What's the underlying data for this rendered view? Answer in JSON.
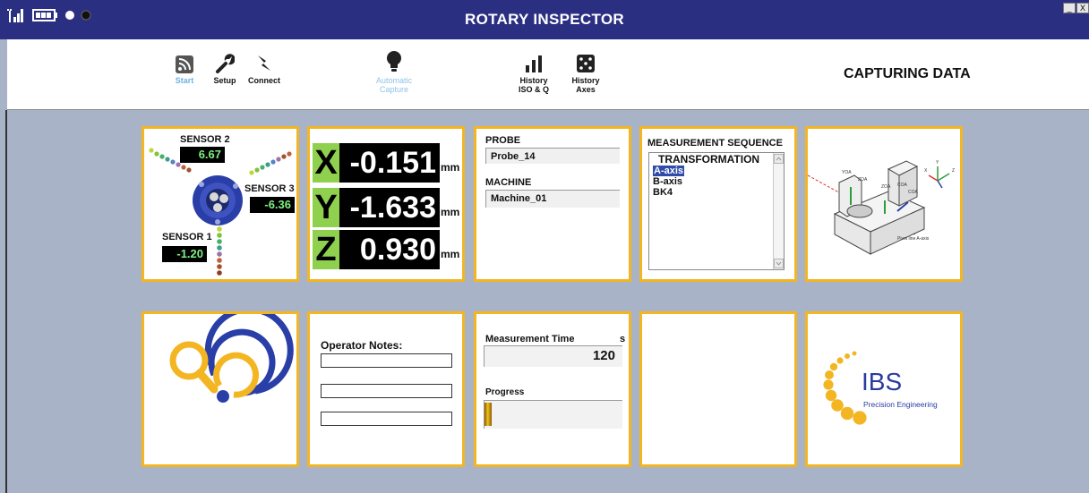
{
  "window": {
    "title": "ROTARY INSPECTOR",
    "minimize_label": "_",
    "close_label": "X"
  },
  "toolbar": {
    "start_label": "Start",
    "setup_label": "Setup",
    "connect_label": "Connect",
    "auto_line1": "Automatic",
    "auto_line2": "Capture",
    "history_iso_line1": "History",
    "history_iso_line2": "ISO & Q",
    "history_axes_line1": "History",
    "history_axes_line2": "Axes",
    "status": "CAPTURING DATA"
  },
  "sensors": {
    "s1_label": "SENSOR 1",
    "s1_value": "-1.20",
    "s2_label": "SENSOR 2",
    "s2_value": "6.67",
    "s3_label": "SENSOR 3",
    "s3_value": "-6.36"
  },
  "coords": {
    "x_letter": "X",
    "x_value": "-0.151",
    "y_letter": "Y",
    "y_value": "-1.633",
    "z_letter": "Z",
    "z_value": "0.930",
    "unit": "mm"
  },
  "probe": {
    "probe_label": "PROBE",
    "probe_value": "Probe_14",
    "machine_label": "MACHINE",
    "machine_value": "Machine_01"
  },
  "sequence": {
    "title": "MEASUREMENT SEQUENCE",
    "items": [
      "TRANSFORMATION",
      "A-axis",
      "B-axis",
      "BK4"
    ],
    "selected_index": 1
  },
  "diagram": {
    "labels": [
      "YOA",
      "ZOA",
      "ZOA",
      "COA",
      "COA",
      "X",
      "Y",
      "Z",
      "Pivot line A-axis"
    ]
  },
  "notes": {
    "label": "Operator Notes:"
  },
  "measurement": {
    "time_label": "Measurement Time",
    "time_unit": "s",
    "time_value": "120",
    "progress_label": "Progress",
    "progress_fraction": 0.05
  },
  "brand": {
    "logo_text": "IBS",
    "tagline": "Precision Engineering"
  },
  "colors": {
    "titlebar": "#2b2f82",
    "panel_border": "#f3b622",
    "background": "#a9b3c7",
    "coord_letter_bg": "#8fd14f",
    "sensor_value": "#7ff07f",
    "brand_blue": "#2a3aa0",
    "brand_yellow": "#f3b622"
  },
  "icons": [
    "signal-icon",
    "battery-icon",
    "status-dot-white-icon",
    "status-dot-black-icon",
    "rss-icon",
    "wrench-icon",
    "lightning-icon",
    "lightbulb-icon",
    "bar-chart-icon",
    "dice-icon",
    "magnifier-target-icon",
    "ibs-logo"
  ]
}
